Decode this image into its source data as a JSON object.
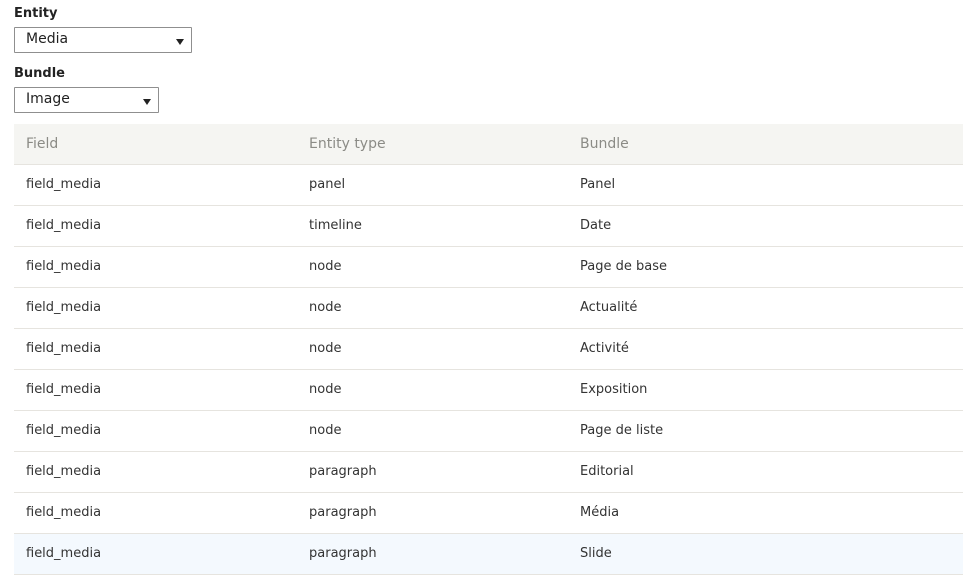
{
  "entity": {
    "label": "Entity",
    "value": "Media"
  },
  "bundle": {
    "label": "Bundle",
    "value": "Image"
  },
  "table": {
    "headers": [
      "Field",
      "Entity type",
      "Bundle"
    ],
    "rows": [
      [
        "field_media",
        "panel",
        "Panel"
      ],
      [
        "field_media",
        "timeline",
        "Date"
      ],
      [
        "field_media",
        "node",
        "Page de base"
      ],
      [
        "field_media",
        "node",
        "Actualité"
      ],
      [
        "field_media",
        "node",
        "Activité"
      ],
      [
        "field_media",
        "node",
        "Exposition"
      ],
      [
        "field_media",
        "node",
        "Page de liste"
      ],
      [
        "field_media",
        "paragraph",
        "Editorial"
      ],
      [
        "field_media",
        "paragraph",
        "Média"
      ],
      [
        "field_media",
        "paragraph",
        "Slide"
      ]
    ]
  }
}
